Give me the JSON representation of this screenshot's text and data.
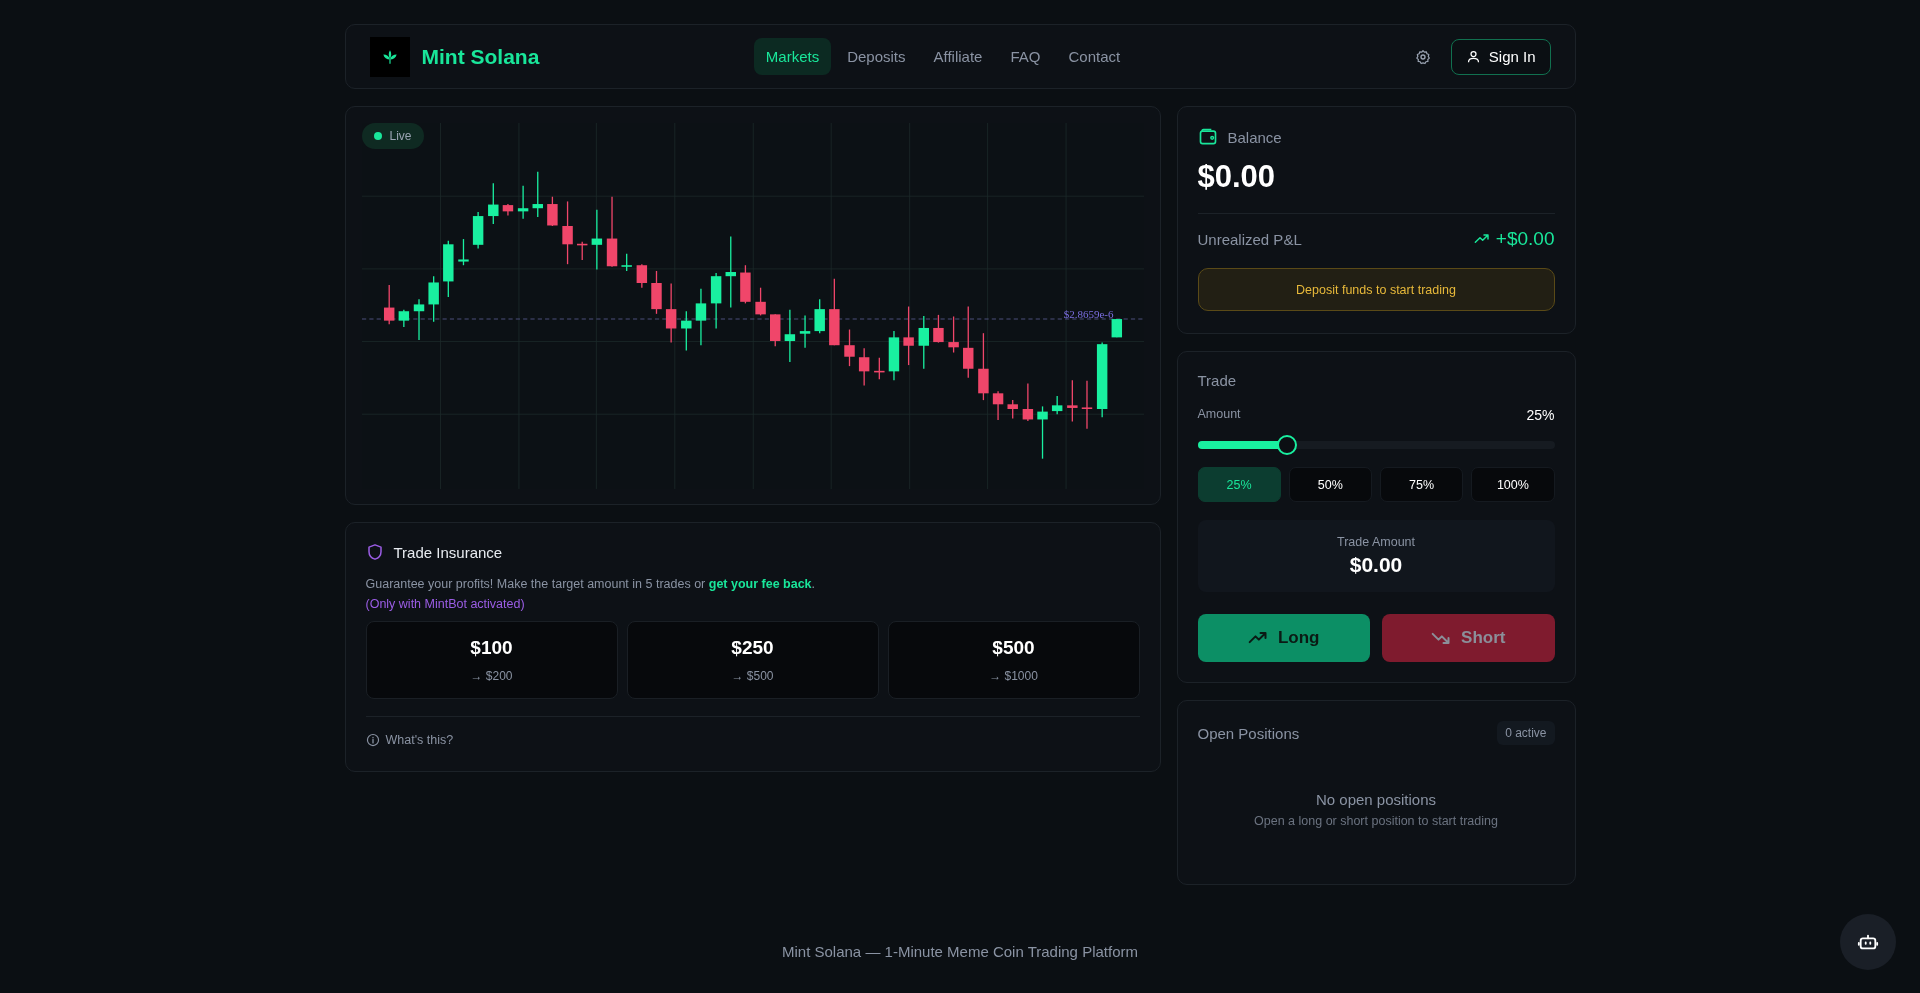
{
  "header": {
    "brand": "Mint Solana",
    "nav": [
      {
        "label": "Markets",
        "selected": true
      },
      {
        "label": "Deposits",
        "selected": false
      },
      {
        "label": "Affiliate",
        "selected": false
      },
      {
        "label": "FAQ",
        "selected": false
      },
      {
        "label": "Contact",
        "selected": false
      }
    ],
    "sign_in": "Sign In"
  },
  "chart": {
    "live": "Live",
    "price_label": "$2.8659e-6"
  },
  "insurance": {
    "title": "Trade Insurance",
    "description": "Guarantee your profits! Make the target amount in 5 trades or **get your fee back**.",
    "note": "(Only with MintBot activated)",
    "tiers": [
      {
        "amount": "$100",
        "target": "→ $200"
      },
      {
        "amount": "$250",
        "target": "→ $500"
      },
      {
        "amount": "$500",
        "target": "→ $1000"
      }
    ],
    "help": "What's this?"
  },
  "balance": {
    "label": "Balance",
    "value": "$0.00",
    "pnl_label": "Unrealized P&L",
    "pnl_value": "+$0.00",
    "notice": "Deposit funds to start trading"
  },
  "trade": {
    "title": "Trade",
    "amount_label": "Amount",
    "amount_value": "25%",
    "level": 0.25,
    "presets": [
      {
        "label": "25%",
        "selected": true
      },
      {
        "label": "50%",
        "selected": false
      },
      {
        "label": "75%",
        "selected": false
      },
      {
        "label": "100%",
        "selected": false
      }
    ],
    "trade_amount_label": "Trade Amount",
    "trade_amount_value": "$0.00",
    "actions": [
      {
        "kind": "long",
        "label": "Long"
      },
      {
        "kind": "short",
        "label": "Short"
      }
    ]
  },
  "positions": {
    "title": "Open Positions",
    "badge": "0 active",
    "empty_title": "No open positions",
    "empty_hint": "Open a long or short position to start trading"
  },
  "footer": "Mint Solana — 1-Minute Meme Coin Trading Platform"
}
